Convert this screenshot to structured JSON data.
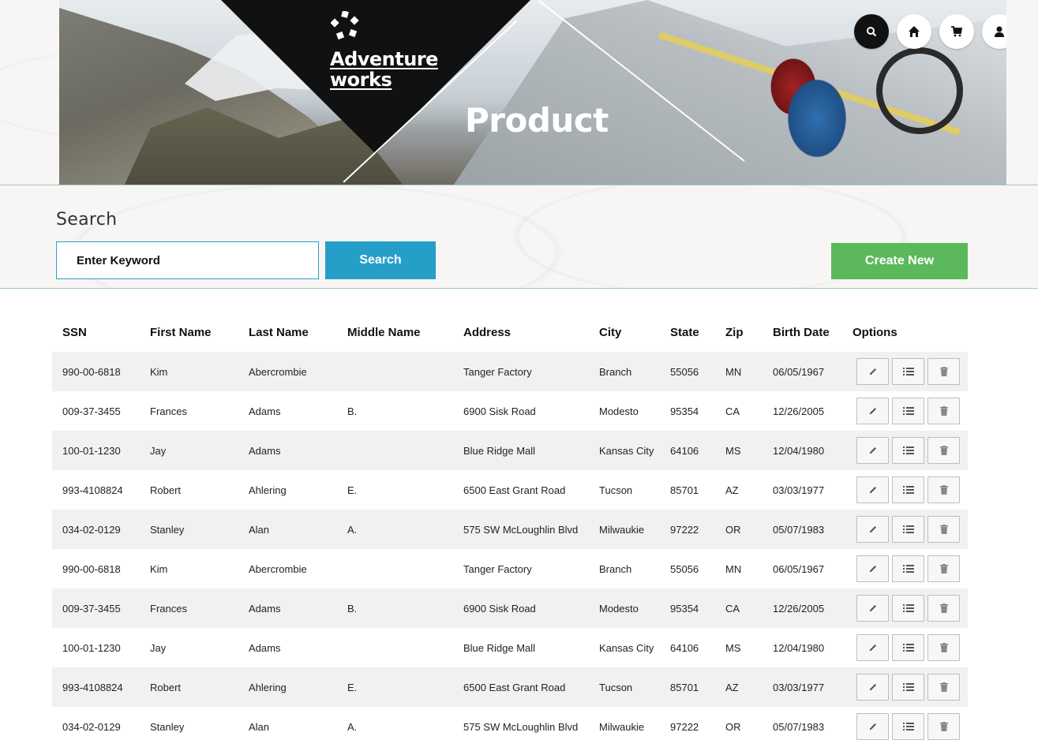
{
  "hero": {
    "brand_line1": "Adventure",
    "brand_line2": "works",
    "title": "Product"
  },
  "nav": {
    "icons": [
      "search-icon",
      "home-icon",
      "cart-icon",
      "user-icon"
    ]
  },
  "search": {
    "label": "Search",
    "placeholder": "Enter Keyword",
    "button_label": "Search",
    "create_label": "Create New"
  },
  "colors": {
    "accent_blue": "#259fc7",
    "create_green": "#5cb85c",
    "row_stripe": "#f1f1f1"
  },
  "table": {
    "headers": [
      "SSN",
      "First Name",
      "Last Name",
      "Middle Name",
      "Address",
      "City",
      "State",
      "Zip",
      "Birth Date",
      "Options"
    ],
    "rows": [
      [
        "990-00-6818",
        "Kim",
        "Abercrombie",
        "",
        "Tanger Factory",
        "Branch",
        "55056",
        "MN",
        "06/05/1967"
      ],
      [
        "009-37-3455",
        "Frances",
        "Adams",
        "B.",
        "6900 Sisk Road",
        "Modesto",
        "95354",
        "CA",
        "12/26/2005"
      ],
      [
        "100-01-1230",
        "Jay",
        "Adams",
        "",
        "Blue Ridge Mall",
        "Kansas City",
        "64106",
        "MS",
        "12/04/1980"
      ],
      [
        "993-4108824",
        "Robert",
        "Ahlering",
        "E.",
        "6500 East Grant Road",
        "Tucson",
        "85701",
        "AZ",
        "03/03/1977"
      ],
      [
        "034-02-0129",
        "Stanley",
        "Alan",
        "A.",
        "575 SW McLoughlin Blvd",
        "Milwaukie",
        "97222",
        "OR",
        "05/07/1983"
      ],
      [
        "990-00-6818",
        "Kim",
        "Abercrombie",
        "",
        "Tanger Factory",
        "Branch",
        "55056",
        "MN",
        "06/05/1967"
      ],
      [
        "009-37-3455",
        "Frances",
        "Adams",
        "B.",
        "6900 Sisk Road",
        "Modesto",
        "95354",
        "CA",
        "12/26/2005"
      ],
      [
        "100-01-1230",
        "Jay",
        "Adams",
        "",
        "Blue Ridge Mall",
        "Kansas City",
        "64106",
        "MS",
        "12/04/1980"
      ],
      [
        "993-4108824",
        "Robert",
        "Ahlering",
        "E.",
        "6500 East Grant Road",
        "Tucson",
        "85701",
        "AZ",
        "03/03/1977"
      ],
      [
        "034-02-0129",
        "Stanley",
        "Alan",
        "A.",
        "575 SW McLoughlin Blvd",
        "Milwaukie",
        "97222",
        "OR",
        "05/07/1983"
      ]
    ],
    "row_option_icons": [
      "edit-icon",
      "details-list-icon",
      "delete-icon"
    ]
  }
}
